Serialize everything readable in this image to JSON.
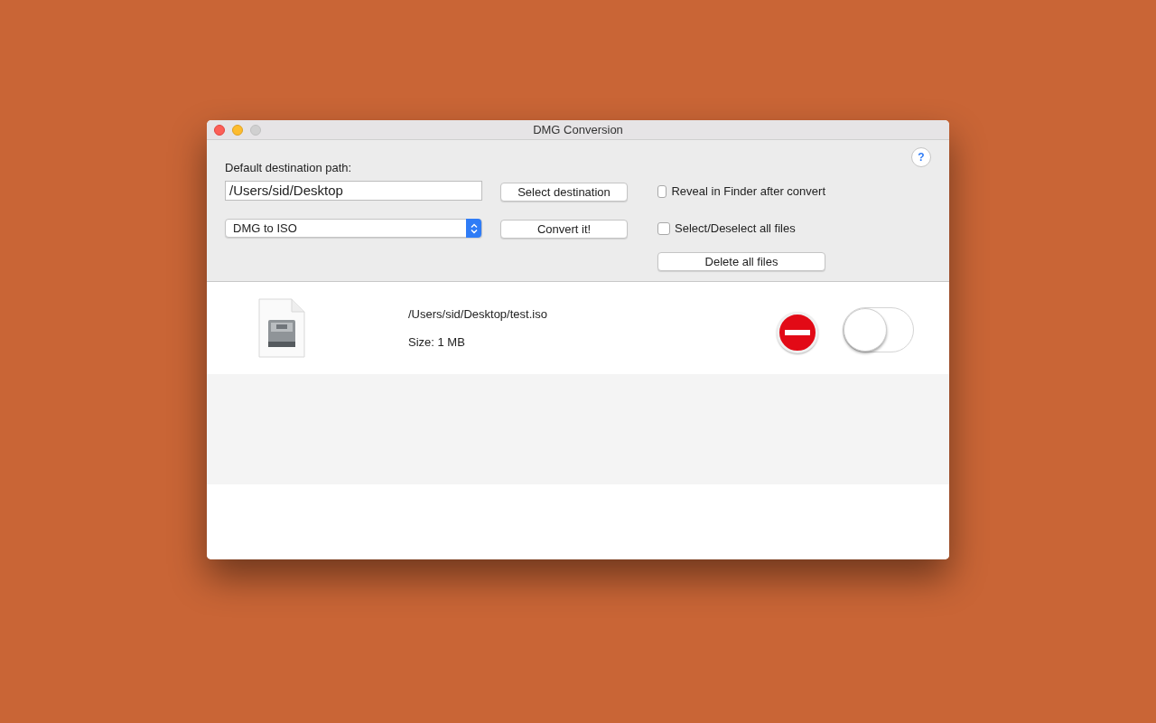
{
  "window": {
    "title": "DMG Conversion"
  },
  "help_button": "?",
  "destination": {
    "label": "Default destination path:",
    "value": "/Users/sid/Desktop"
  },
  "format_select": {
    "value": "DMG to ISO"
  },
  "buttons": {
    "select_destination": "Select destination",
    "convert": "Convert it!",
    "delete_all": "Delete all files"
  },
  "options": [
    {
      "label": "Reveal in Finder after convert",
      "checked": false
    },
    {
      "label": "Select/Deselect all files",
      "checked": false
    }
  ],
  "files": [
    {
      "path": "/Users/sid/Desktop/test.iso",
      "size": "Size: 1 MB",
      "on": false
    }
  ]
}
